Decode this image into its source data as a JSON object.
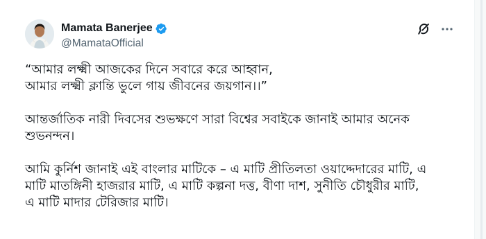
{
  "author": {
    "display_name": "Mamata Banerjee",
    "handle": "@MamataOfficial",
    "verified": true,
    "avatar": "profile-photo"
  },
  "header_actions": [
    {
      "icon": "grok-icon"
    },
    {
      "icon": "more-icon"
    }
  ],
  "tweet": {
    "paragraphs": [
      {
        "lines": [
          "“আমার লক্ষ্মী আজকের দিনে সবারে করে আহ্বান,",
          "আমার লক্ষ্মী ক্লান্তি ভুলে গায় জীবনের জয়গান।।”"
        ]
      },
      {
        "lines": [
          "আন্তর্জাতিক নারী দিবসের শুভক্ষণে সারা বিশ্বের সবাইকে জানাই আমার অনেক",
          "শুভনন্দন।"
        ]
      },
      {
        "lines": [
          "আমি কুর্নিশ জানাই এই বাংলার মাটিকে – এ মাটি প্রীতিলতা ওয়াদ্দেদারের মাটি, এ",
          "মাটি মাতঙ্গিনী হাজরার মাটি, এ মাটি কল্পনা দত্ত, বীণা দাশ, সুনীতি চৌধুরীর মাটি,",
          "এ মাটি মাদার টেরিজার মাটি।"
        ]
      }
    ]
  },
  "colors": {
    "text_primary": "#0f1419",
    "text_secondary": "#536471",
    "verified_blue": "#1d9bf0",
    "background": "#ffffff"
  }
}
